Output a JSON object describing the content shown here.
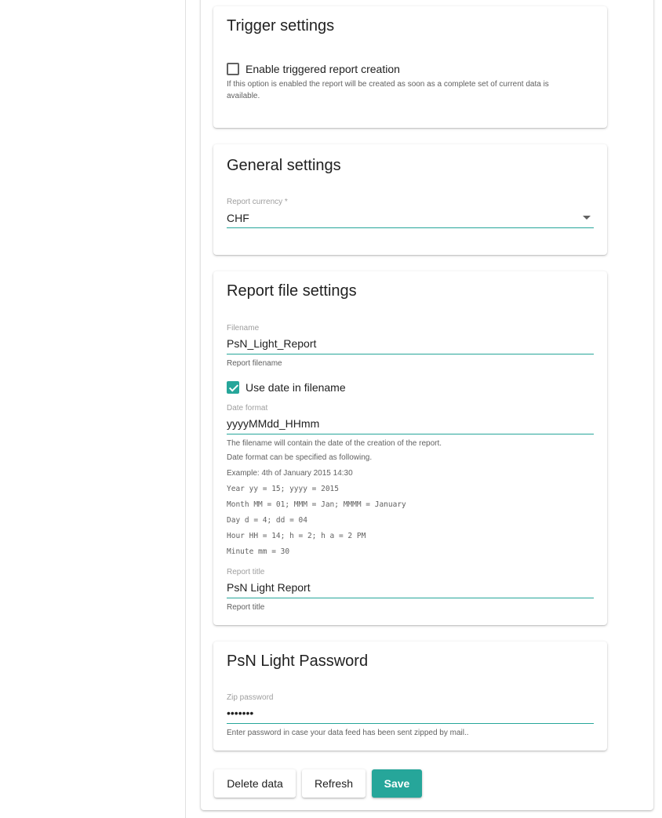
{
  "trigger": {
    "title": "Trigger settings",
    "enable_label": "Enable triggered report creation",
    "enable_checked": false,
    "hint_line1": "If this option is enabled the report will be created as soon as a complete set of current data is",
    "hint_line2": "available."
  },
  "general": {
    "title": "General settings",
    "currency_label": "Report currency *",
    "currency_value": "CHF"
  },
  "report_file": {
    "title": "Report file settings",
    "filename_label": "Filename",
    "filename_value": "PsN_Light_Report",
    "filename_hint": "Report filename",
    "use_date_label": "Use date in filename",
    "use_date_checked": true,
    "date_format_label": "Date format",
    "date_format_value": "yyyyMMdd_HHmm",
    "date_hints": [
      "The filename will contain the date of the creation of the report.",
      "Date format can be specified as following.",
      "Example: 4th of January 2015 14:30"
    ],
    "date_examples": [
      "Year yy = 15; yyyy = 2015",
      "Month MM = 01; MMM = Jan; MMMM = January",
      "Day d = 4; dd = 04",
      "Hour HH = 14; h = 2; h a = 2 PM",
      "Minute mm = 30"
    ],
    "title_label": "Report title",
    "title_value": "PsN Light Report",
    "title_hint": "Report title"
  },
  "password": {
    "title": "PsN Light Password",
    "zip_label": "Zip password",
    "zip_value": "•••••••",
    "zip_hint": "Enter password in case your data feed has been sent zipped by mail.."
  },
  "actions": {
    "delete_label": "Delete data",
    "refresh_label": "Refresh",
    "save_label": "Save"
  },
  "colors": {
    "accent": "#26a69a"
  }
}
